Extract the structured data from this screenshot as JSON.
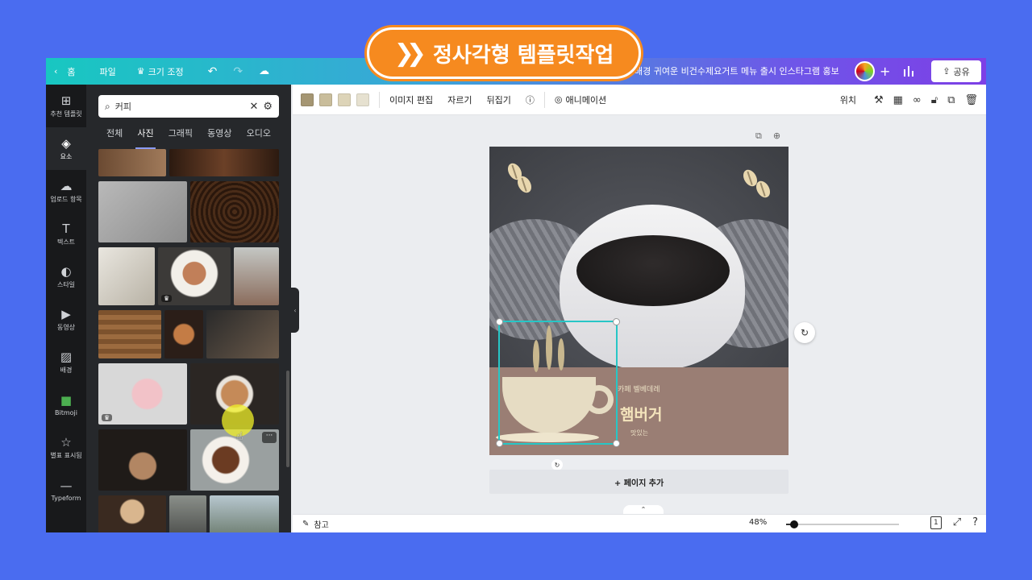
{
  "banner": {
    "text": "정사각형 템플릿작업"
  },
  "topbar": {
    "home": "홈",
    "file": "파일",
    "resize": "크기 조정",
    "doc_title": "l배경 귀여운 비건수제요거트 메뉴 출시 인스타그램 홍보",
    "share": "공유"
  },
  "rail": [
    {
      "label": "추천 템플릿",
      "icon": "template-icon"
    },
    {
      "label": "요소",
      "icon": "elements-icon"
    },
    {
      "label": "업로드 항목",
      "icon": "upload-icon"
    },
    {
      "label": "텍스트",
      "icon": "text-icon"
    },
    {
      "label": "스타일",
      "icon": "style-icon"
    },
    {
      "label": "동영상",
      "icon": "video-icon"
    },
    {
      "label": "배경",
      "icon": "background-icon"
    },
    {
      "label": "Bitmoji",
      "icon": "bitmoji-icon"
    },
    {
      "label": "별표 표시됨",
      "icon": "star-icon"
    },
    {
      "label": "Typeform",
      "icon": "typeform-icon"
    }
  ],
  "search": {
    "value": "커피"
  },
  "tabs": [
    "전체",
    "사진",
    "그래픽",
    "동영상",
    "오디오"
  ],
  "colors": {
    "swatch1": "#a59673",
    "swatch2": "#c9bd9b",
    "swatch3": "#ddd4b8",
    "swatch4": "#e6e1d0",
    "band": "#9a7e74",
    "accent": "#27c6c6"
  },
  "ctx": {
    "edit_image": "이미지 편집",
    "crop": "자르기",
    "flip": "뒤집기",
    "animate": "애니메이션",
    "position": "위치"
  },
  "design": {
    "small_text": "카페 벨베데레",
    "big_text": "햄버거",
    "sub_text": "맛있는"
  },
  "add_page": "+ 페이지 추가",
  "bottombar": {
    "notes": "참고",
    "zoom": "48%",
    "zoom_percent": 48,
    "page_number": "1"
  }
}
